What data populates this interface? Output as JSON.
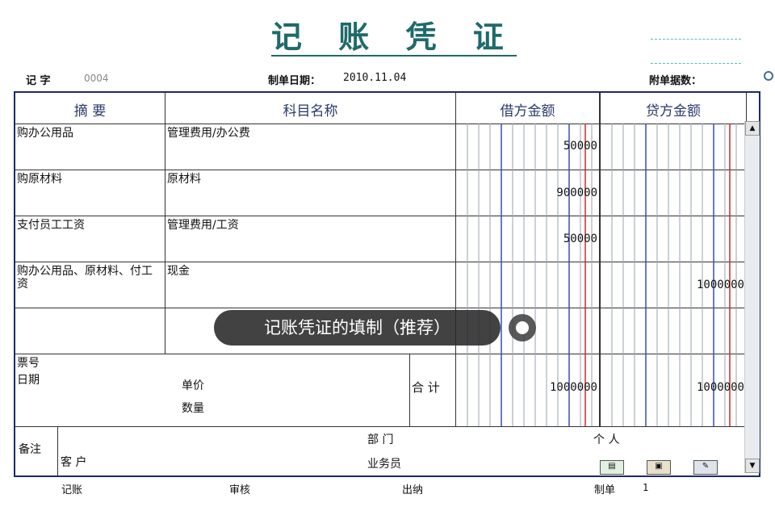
{
  "header": {
    "title": "记 账 凭 证",
    "voucher_word_label": "记 字",
    "voucher_number": "0004",
    "date_label": "制单日期：",
    "date_value": "2010.11.04",
    "attachments_label": "附单据数：",
    "lookup_icon": "magnifier-icon"
  },
  "table": {
    "columns": [
      "摘 要",
      "科目名称",
      "借方金额",
      "贷方金额"
    ],
    "rows": [
      {
        "summary": "购办公用品",
        "account": "管理费用/办公费",
        "debit": "50000",
        "credit": ""
      },
      {
        "summary": "购原材料",
        "account": "原材料",
        "debit": "900000",
        "credit": ""
      },
      {
        "summary": "支付员工工资",
        "account": "管理费用/工资",
        "debit": "50000",
        "credit": ""
      },
      {
        "summary": "购办公用品、原材料、付工资",
        "account": "现金",
        "debit": "",
        "credit": "1000000"
      },
      {
        "summary": "",
        "account": "",
        "debit": "",
        "credit": ""
      }
    ]
  },
  "footer_block": {
    "ticket_label": "票号",
    "date_label": "日期",
    "price_label": "单价",
    "qty_label": "数量",
    "total_label": "合 计",
    "total_debit": "1000000",
    "total_credit": "1000000"
  },
  "remarks": {
    "label": "备注",
    "department_label": "部  门",
    "person_label": "个  人",
    "customer_label": "客  户",
    "salesperson_label": "业务员"
  },
  "signatures": {
    "bookkeeping": "记账",
    "audit": "审核",
    "cashier": "出纳",
    "preparer": "制单",
    "preparer_value": "1"
  },
  "overlay": {
    "caption": "记账凭证的填制（推荐）"
  },
  "colors": {
    "title": "#1f6a6a",
    "border": "#1b2a66",
    "grid_blue": "#3a4fb0",
    "grid_red": "#d02828",
    "grid_gray": "#9aa0b0"
  }
}
